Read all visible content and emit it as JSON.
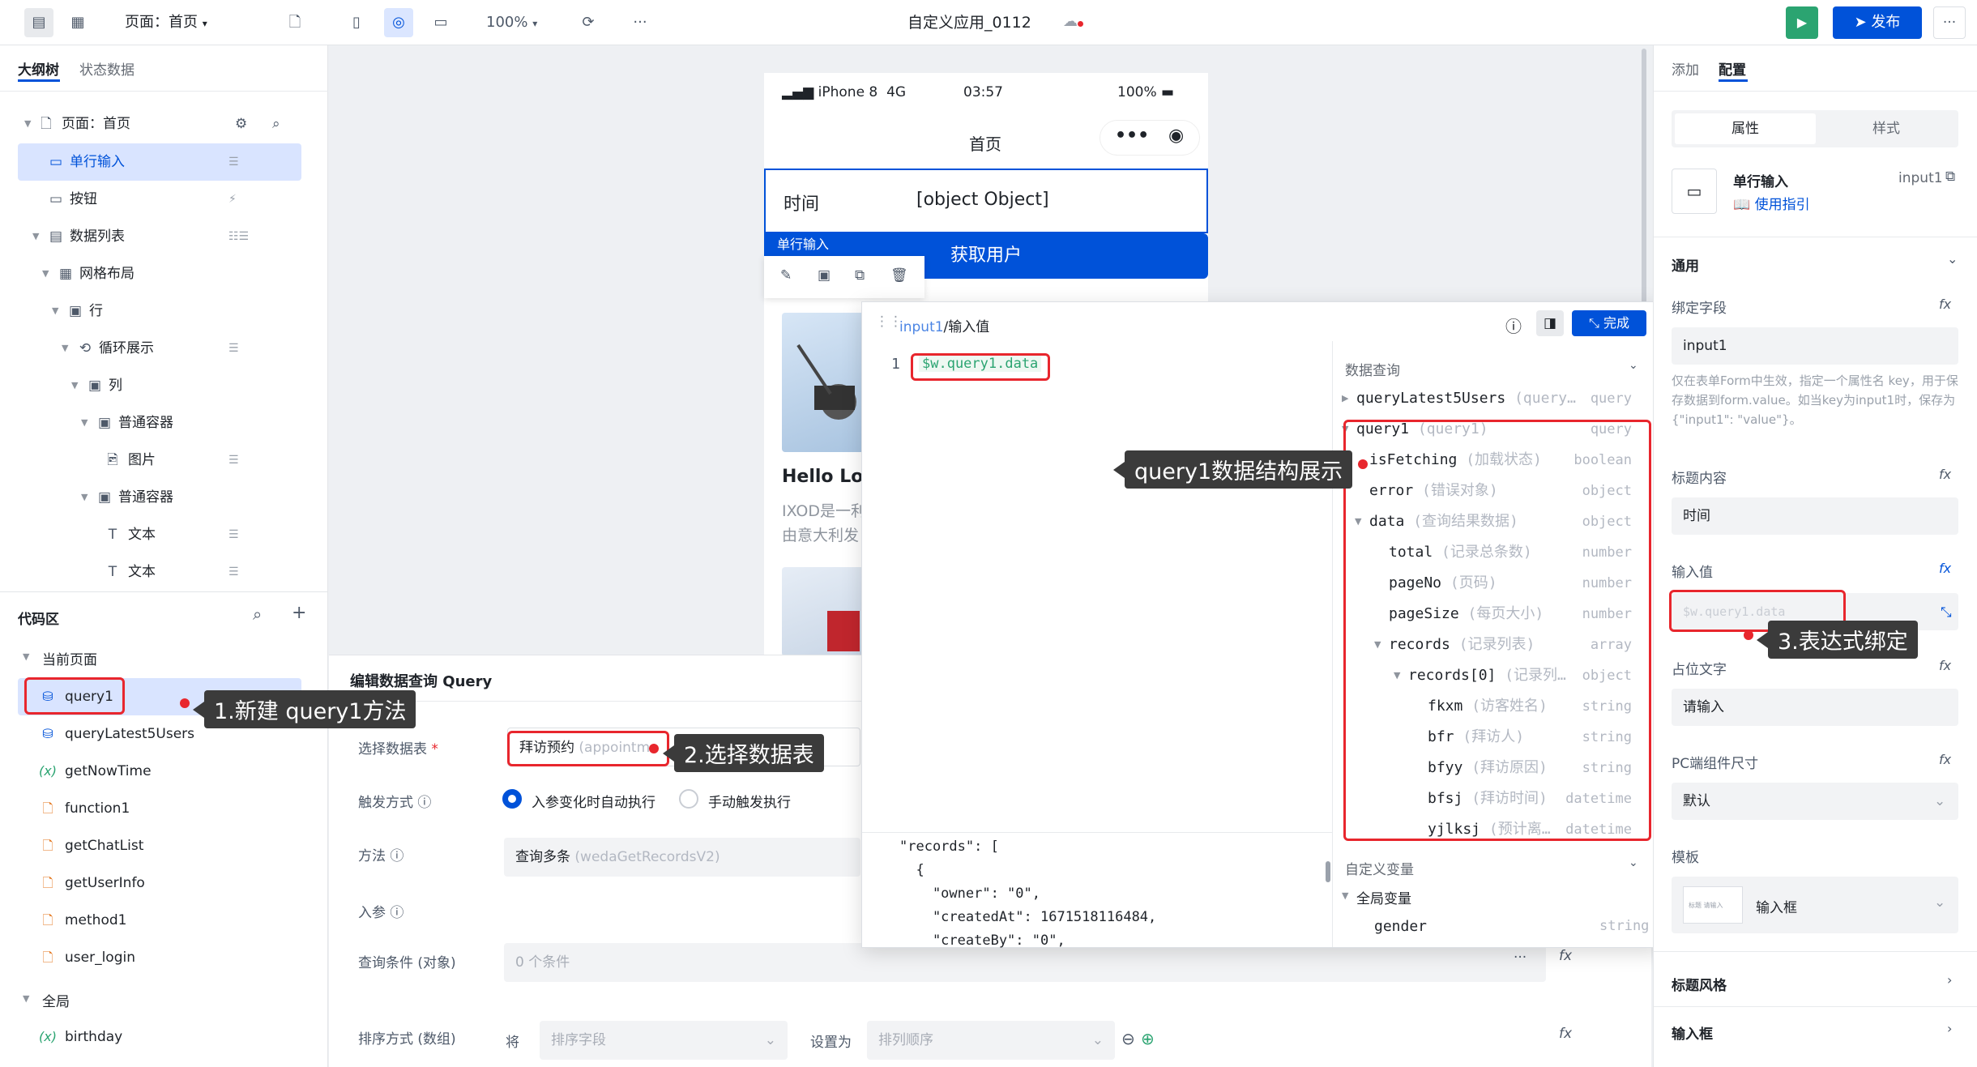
{
  "topbar": {
    "page_select": "页面：首页",
    "zoom": "100%",
    "app_title": "自定义应用_0112",
    "publish_label": "发布"
  },
  "left": {
    "tabs": [
      "大纲树",
      "状态数据"
    ],
    "tree": {
      "page": "页面：首页",
      "input": "单行输入",
      "button": "按钮",
      "datalist": "数据列表",
      "grid": "网格布局",
      "row": "行",
      "loop": "循环展示",
      "col": "列",
      "container1": "普通容器",
      "image": "图片",
      "container2": "普通容器",
      "text1": "文本",
      "text2": "文本"
    },
    "code_title": "代码区",
    "current_page": "当前页面",
    "code_items": [
      "query1",
      "queryLatest5Users",
      "getNowTime",
      "function1",
      "getChatList",
      "getUserInfo",
      "method1",
      "user_login"
    ],
    "global": "全局",
    "global_items": [
      "birthday"
    ]
  },
  "phone": {
    "carrier": "iPhone 8",
    "network": "4G",
    "time": "03:57",
    "battery": "100%",
    "nav_title": "首页",
    "field_label": "时间",
    "field_value": "[object Object]",
    "selection_tag": "单行输入",
    "button_label": "获取用户",
    "card_title": "Hello Lov",
    "card_text1": "IXOD是一利",
    "card_text2": "由意大利发"
  },
  "editor": {
    "title": "编辑数据查询 Query",
    "table_label": "选择数据表",
    "table_value": "拜访预约",
    "table_value_sub": "(appointme",
    "trigger_label": "触发方式",
    "trigger_auto": "入参变化时自动执行",
    "trigger_manual": "手动触发执行",
    "method_label": "方法",
    "method_value": "查询多条",
    "method_sub": "(wedaGetRecordsV2)",
    "params_label": "入参",
    "condition_label": "查询条件 (对象)",
    "condition_value": "0 个条件",
    "sort_label": "排序方式 (数组)",
    "sort_prefix": "将",
    "sort_field": "排序字段",
    "sort_setas": "设置为",
    "sort_order": "排列顺序"
  },
  "popup": {
    "breadcrumb_ref": "input1",
    "breadcrumb_sep": "/",
    "breadcrumb_field": "输入值",
    "done_label": "完成",
    "line_no": "1",
    "expression": "$w.query1.data",
    "json_preview": [
      "\"records\": [",
      "  {",
      "    \"owner\": \"0\",",
      "    \"createdAt\": 1671518116484,",
      "    \"createBy\": \"0\","
    ],
    "section_query": "数据查询",
    "section_vars": "自定义变量",
    "global_vars": "全局变量",
    "rows": [
      {
        "name": "queryLatest5Users",
        "cn": "(query…",
        "type": "query"
      },
      {
        "name": "query1",
        "cn": "(query1)",
        "type": "query"
      },
      {
        "name": "isFetching",
        "cn": "(加载状态)",
        "type": "boolean"
      },
      {
        "name": "error",
        "cn": "(错误对象)",
        "type": "object"
      },
      {
        "name": "data",
        "cn": "(查询结果数据)",
        "type": "object"
      },
      {
        "name": "total",
        "cn": "(记录总条数)",
        "type": "number"
      },
      {
        "name": "pageNo",
        "cn": "(页码)",
        "type": "number"
      },
      {
        "name": "pageSize",
        "cn": "(每页大小)",
        "type": "number"
      },
      {
        "name": "records",
        "cn": "(记录列表)",
        "type": "array"
      },
      {
        "name": "records[0]",
        "cn": "(记录列…",
        "type": "object"
      },
      {
        "name": "fkxm",
        "cn": "(访客姓名)",
        "type": "string"
      },
      {
        "name": "bfr",
        "cn": "(拜访人)",
        "type": "string"
      },
      {
        "name": "bfyy",
        "cn": "(拜访原因)",
        "type": "string"
      },
      {
        "name": "bfsj",
        "cn": "(拜访时间)",
        "type": "datetime"
      },
      {
        "name": "yjlksj",
        "cn": "(预计离…",
        "type": "datetime"
      }
    ],
    "var_row": {
      "name": "gender",
      "type": "string"
    }
  },
  "right": {
    "tabs": [
      "添加",
      "配置"
    ],
    "seg": [
      "属性",
      "样式"
    ],
    "comp_name": "单行输入",
    "comp_id": "input1",
    "guide": "使用指引",
    "general": "通用",
    "bind_label": "绑定字段",
    "bind_value": "input1",
    "bind_help": "仅在表单Form中生效，指定一个属性名 key，用于保存数据到form.value。如当key为input1时，保存为{\"input1\": \"value\"}。",
    "title_label": "标题内容",
    "title_value": "时间",
    "input_label": "输入值",
    "input_value": "$w.query1.data",
    "placeholder_label": "占位文字",
    "placeholder_value": "请输入",
    "size_label": "PC端组件尺寸",
    "size_value": "默认",
    "template_label": "模板",
    "template_value": "输入框",
    "template_thumb": "标题  请输入",
    "sec_title_style": "标题风格",
    "sec_input": "输入框"
  },
  "annotations": {
    "a1": "1.新建 query1方法",
    "a2": "2.选择数据表",
    "a3": "3.表达式绑定",
    "a4": "query1数据结构展示"
  }
}
